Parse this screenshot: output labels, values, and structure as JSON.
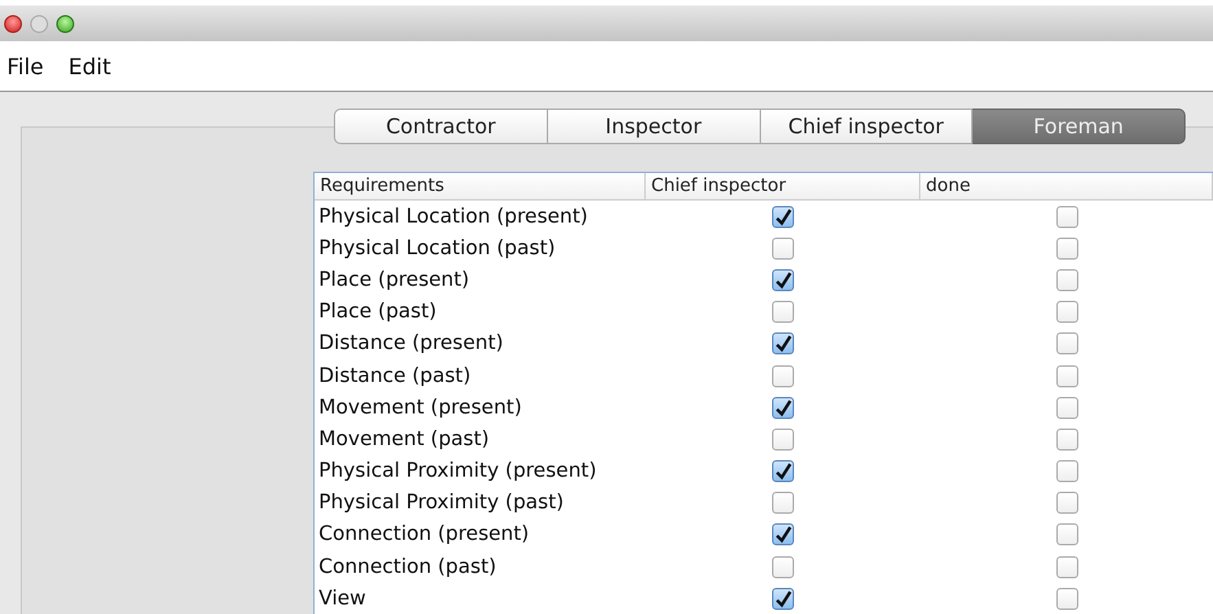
{
  "menu": [
    "File",
    "Edit"
  ],
  "tabs": [
    {
      "label": "Contractor",
      "selected": false
    },
    {
      "label": "Inspector",
      "selected": false
    },
    {
      "label": "Chief inspector",
      "selected": false
    },
    {
      "label": "Foreman",
      "selected": true
    }
  ],
  "table": {
    "columns": [
      "Requirements",
      "Chief inspector",
      "done"
    ],
    "rows": [
      {
        "requirement": "Physical Location (present)",
        "chief_inspector": true,
        "done": false
      },
      {
        "requirement": "Physical Location (past)",
        "chief_inspector": false,
        "done": false
      },
      {
        "requirement": "Place (present)",
        "chief_inspector": true,
        "done": false
      },
      {
        "requirement": "Place (past)",
        "chief_inspector": false,
        "done": false
      },
      {
        "requirement": "Distance (present)",
        "chief_inspector": true,
        "done": false
      },
      {
        "requirement": "Distance (past)",
        "chief_inspector": false,
        "done": false
      },
      {
        "requirement": "Movement (present)",
        "chief_inspector": true,
        "done": false
      },
      {
        "requirement": "Movement (past)",
        "chief_inspector": false,
        "done": false
      },
      {
        "requirement": "Physical Proximity (present)",
        "chief_inspector": true,
        "done": false
      },
      {
        "requirement": "Physical Proximity (past)",
        "chief_inspector": false,
        "done": false
      },
      {
        "requirement": "Connection (present)",
        "chief_inspector": true,
        "done": false
      },
      {
        "requirement": "Connection (past)",
        "chief_inspector": false,
        "done": false
      },
      {
        "requirement": "View",
        "chief_inspector": true,
        "done": false
      }
    ]
  }
}
